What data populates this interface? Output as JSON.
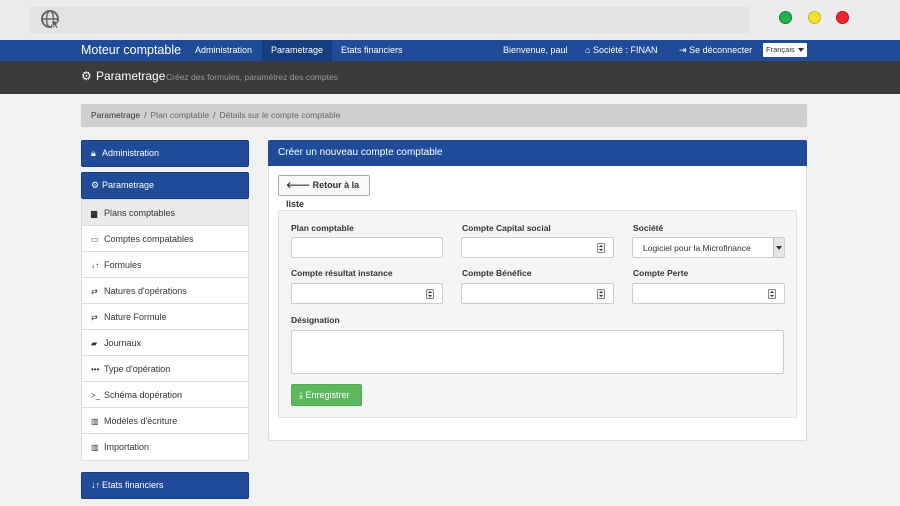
{
  "browser": {
    "logo_icon": "globe-cursor-icon",
    "window_controls": [
      "green",
      "yellow",
      "red"
    ]
  },
  "navbar": {
    "brand": "Moteur comptable",
    "items": [
      {
        "label": "Administration",
        "active": false
      },
      {
        "label": "Parametrage",
        "active": true
      },
      {
        "label": "Etats financiers",
        "active": false
      }
    ],
    "welcome": "Bienvenue, paul",
    "company": "Société : FINAN",
    "logout": "Se déconnecter",
    "language": "Français"
  },
  "header": {
    "title": "Parametrage",
    "subtitle": "Créez des formules, paramétrez des comptes"
  },
  "breadcrumb": [
    "Parametrage",
    "Plan comptable",
    "Détails sur le compte comptable"
  ],
  "sidebar": {
    "administration_label": "Administration",
    "parametrage_label": "Parametrage",
    "etats_label": "Etats financiers",
    "items": [
      {
        "label": "Plans comptables",
        "icon": "folder-icon",
        "active": true
      },
      {
        "label": "Comptes compatables",
        "icon": "hdd-icon",
        "active": false
      },
      {
        "label": "Formules",
        "icon": "sort-icon",
        "active": false
      },
      {
        "label": "Natures d'opérations",
        "icon": "transfer-icon",
        "active": false
      },
      {
        "label": "Nature Formule",
        "icon": "transfer-icon",
        "active": false
      },
      {
        "label": "Journaux",
        "icon": "folder-open-icon",
        "active": false
      },
      {
        "label": "Type d'opération",
        "icon": "ellipsis-icon",
        "active": false
      },
      {
        "label": "Schéma dopération",
        "icon": "console-icon",
        "active": false
      },
      {
        "label": "Modèles d'écriture",
        "icon": "tasks-icon",
        "active": false
      },
      {
        "label": "Importation",
        "icon": "tasks-icon",
        "active": false
      }
    ]
  },
  "main": {
    "title": "Créer un nouveau compte comptable",
    "back_button": "Retour à la liste",
    "fields": {
      "plan_comptable": "Plan comptable",
      "compte_capital": "Compte Capital social",
      "societe": "Société",
      "societe_value": "Logiciel pour la Microfinance",
      "compte_resultat": "Compte résultat instance",
      "compte_benefice": "Compte Bénéfice",
      "compte_perte": "Compte Perte",
      "designation": "Désignation"
    },
    "save_button": "Enregistrer"
  },
  "colors": {
    "primary": "#1f4b99",
    "header_band": "#3a3a3a",
    "success": "#5cb85c"
  }
}
